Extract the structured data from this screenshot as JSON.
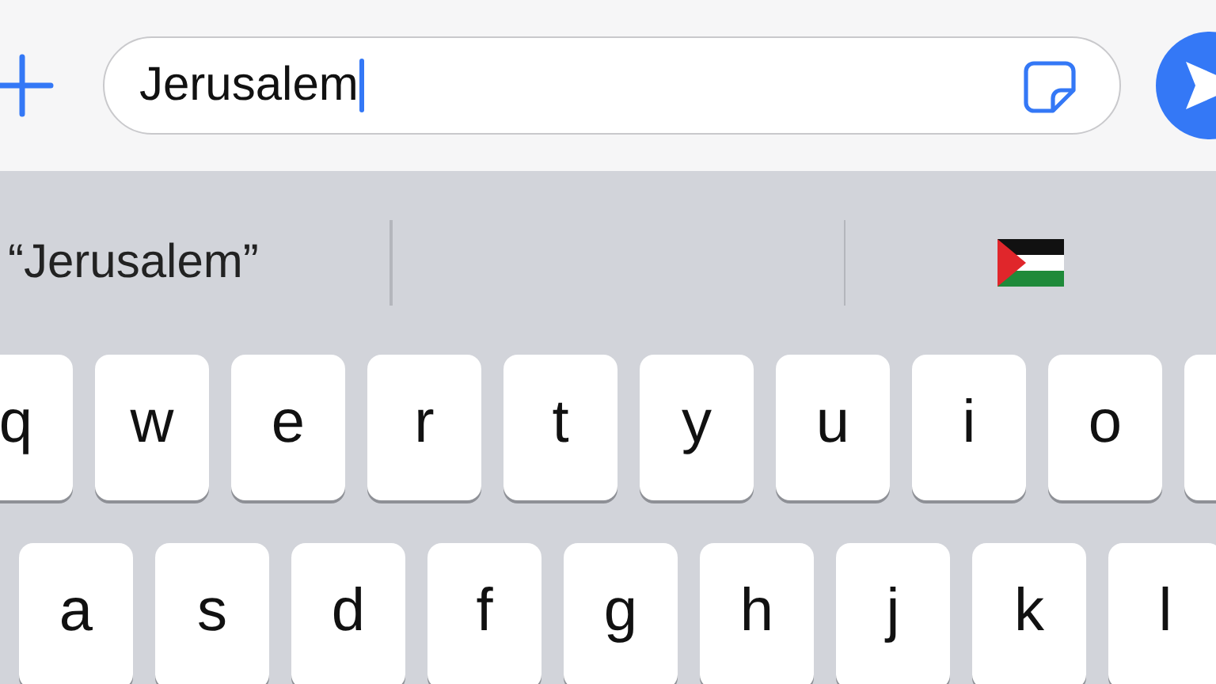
{
  "message_field": {
    "value": "Jerusalem",
    "focused": true
  },
  "suggestions": [
    {
      "kind": "text",
      "text": "“Jerusalem”"
    },
    {
      "kind": "blank"
    },
    {
      "kind": "flag"
    }
  ],
  "keyboard": {
    "rows": [
      [
        {
          "kind": "letter",
          "label": "q"
        },
        {
          "kind": "letter",
          "label": "w"
        },
        {
          "kind": "letter",
          "label": "e"
        },
        {
          "kind": "letter",
          "label": "r"
        },
        {
          "kind": "letter",
          "label": "t"
        },
        {
          "kind": "letter",
          "label": "y"
        },
        {
          "kind": "letter",
          "label": "u"
        },
        {
          "kind": "letter",
          "label": "i"
        },
        {
          "kind": "letter",
          "label": "o"
        },
        {
          "kind": "edge"
        }
      ],
      [
        {
          "kind": "letter",
          "label": "a"
        },
        {
          "kind": "letter",
          "label": "s"
        },
        {
          "kind": "letter",
          "label": "d"
        },
        {
          "kind": "letter",
          "label": "f"
        },
        {
          "kind": "letter",
          "label": "g"
        },
        {
          "kind": "letter",
          "label": "h"
        },
        {
          "kind": "letter",
          "label": "j"
        },
        {
          "kind": "letter",
          "label": "k"
        },
        {
          "kind": "letter",
          "label": "l"
        }
      ]
    ]
  }
}
